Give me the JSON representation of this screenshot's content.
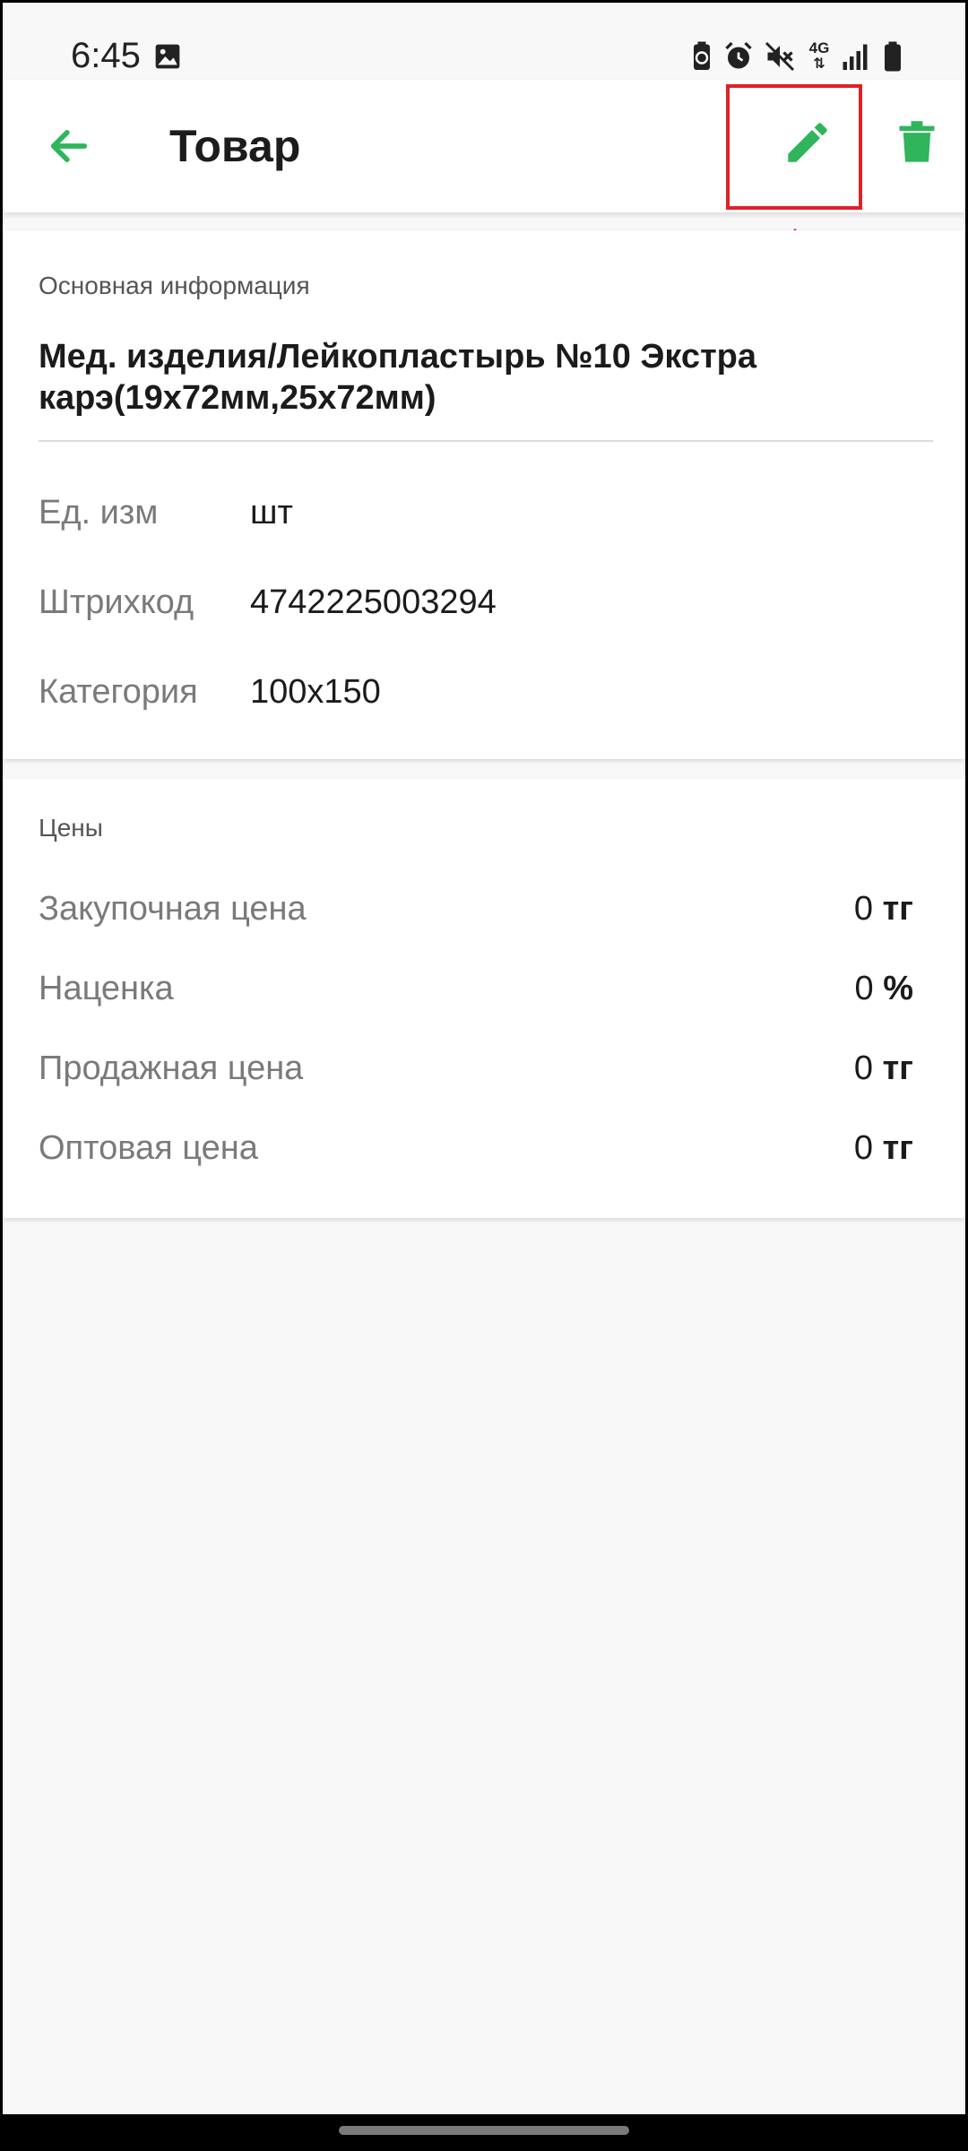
{
  "status_bar": {
    "time": "6:45",
    "icons": [
      "gallery-icon",
      "battery-saver-icon",
      "alarm-icon",
      "mute-icon",
      "network-4g-icon",
      "signal-icon",
      "battery-icon"
    ],
    "network_label": "4G"
  },
  "app_bar": {
    "title": "Товар",
    "back_icon": "arrow-left-icon",
    "edit_icon": "pencil-icon",
    "delete_icon": "trash-icon"
  },
  "colors": {
    "accent": "#2fb55a",
    "highlight": "#e02127"
  },
  "main_info": {
    "section_title": "Основная информация",
    "product_name": "Мед. изделия/Лейкопластырь №10 Экстра карэ(19x72мм,25x72мм)",
    "fields": [
      {
        "label": "Ед. изм",
        "value": "шт"
      },
      {
        "label": "Штрихкод",
        "value": "4742225003294"
      },
      {
        "label": "Категория",
        "value": "100x150"
      }
    ]
  },
  "prices": {
    "section_title": "Цены",
    "rows": [
      {
        "label": "Закупочная цена",
        "value": "0",
        "unit": "тг"
      },
      {
        "label": "Наценка",
        "value": "0",
        "unit": "%"
      },
      {
        "label": "Продажная цена",
        "value": "0",
        "unit": "тг"
      },
      {
        "label": "Оптовая цена",
        "value": "0",
        "unit": "тг"
      }
    ]
  }
}
